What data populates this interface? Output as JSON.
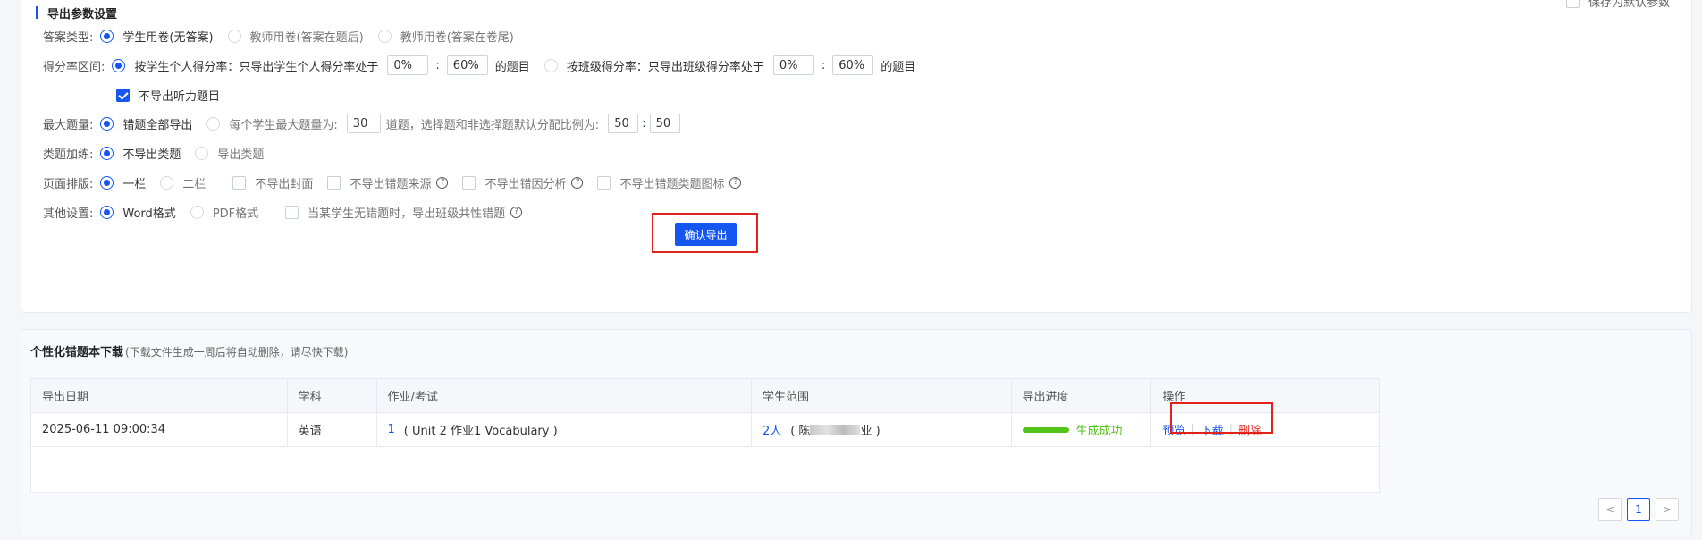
{
  "export_settings": {
    "title": "导出参数设置",
    "save_default": "保存为默认参数",
    "answer_type": {
      "label": "答案类型:",
      "options": [
        "学生用卷(无答案)",
        "教师用卷(答案在题后)",
        "教师用卷(答案在卷尾)"
      ],
      "selected": 0
    },
    "score_range": {
      "label": "得分率区间:",
      "personal": {
        "text": "按学生个人得分率：只导出学生个人得分率处于",
        "min": "0%",
        "max": "60%",
        "suffix": "的题目"
      },
      "class": {
        "text": "按班级得分率：只导出班级得分率处于",
        "min": "0%",
        "max": "60%",
        "suffix": "的题目"
      },
      "colon": ":"
    },
    "no_listening": {
      "label": "不导出听力题目",
      "checked": true
    },
    "max_questions": {
      "label": "最大题量:",
      "opt_all": "错题全部导出",
      "opt_limit": "每个学生最大题量为:",
      "limit_value": "30",
      "ratio_text": "道题，选择题和非选择题默认分配比例为:",
      "ratio_a": "50",
      "ratio_b": "50",
      "colon": ":"
    },
    "similar": {
      "label": "类题加练:",
      "options": [
        "不导出类题",
        "导出类题"
      ]
    },
    "layout": {
      "label": "页面排版:",
      "options": [
        "一栏",
        "二栏"
      ],
      "checks": [
        "不导出封面",
        "不导出错题来源",
        "不导出错因分析",
        "不导出错题类题图标"
      ]
    },
    "other": {
      "label": "其他设置:",
      "options": [
        "Word格式",
        "PDF格式"
      ],
      "check": "当某学生无错题时，导出班级共性错题"
    },
    "confirm": "确认导出"
  },
  "downloads": {
    "title": "个性化错题本下载",
    "note": "(下载文件生成一周后将自动删除，请尽快下载)",
    "columns": [
      "导出日期",
      "学科",
      "作业/考试",
      "学生范围",
      "导出进度",
      "操作"
    ],
    "row": {
      "date": "2025-06-11 09:00:34",
      "subject": "英语",
      "count": "1",
      "hw": "( Unit 2   作业1   Vocabulary )",
      "students": "2人",
      "range_pre": "( 陈",
      "range_post": "业 )",
      "status": "生成成功",
      "progress": 1.0,
      "ops": [
        "预览",
        "下载",
        "删除"
      ]
    },
    "pager": {
      "prev": "<",
      "page": "1",
      "next": ">"
    }
  },
  "colors": {
    "primary": "#1656f0",
    "success": "#52c41a",
    "danger": "#e0221b"
  }
}
